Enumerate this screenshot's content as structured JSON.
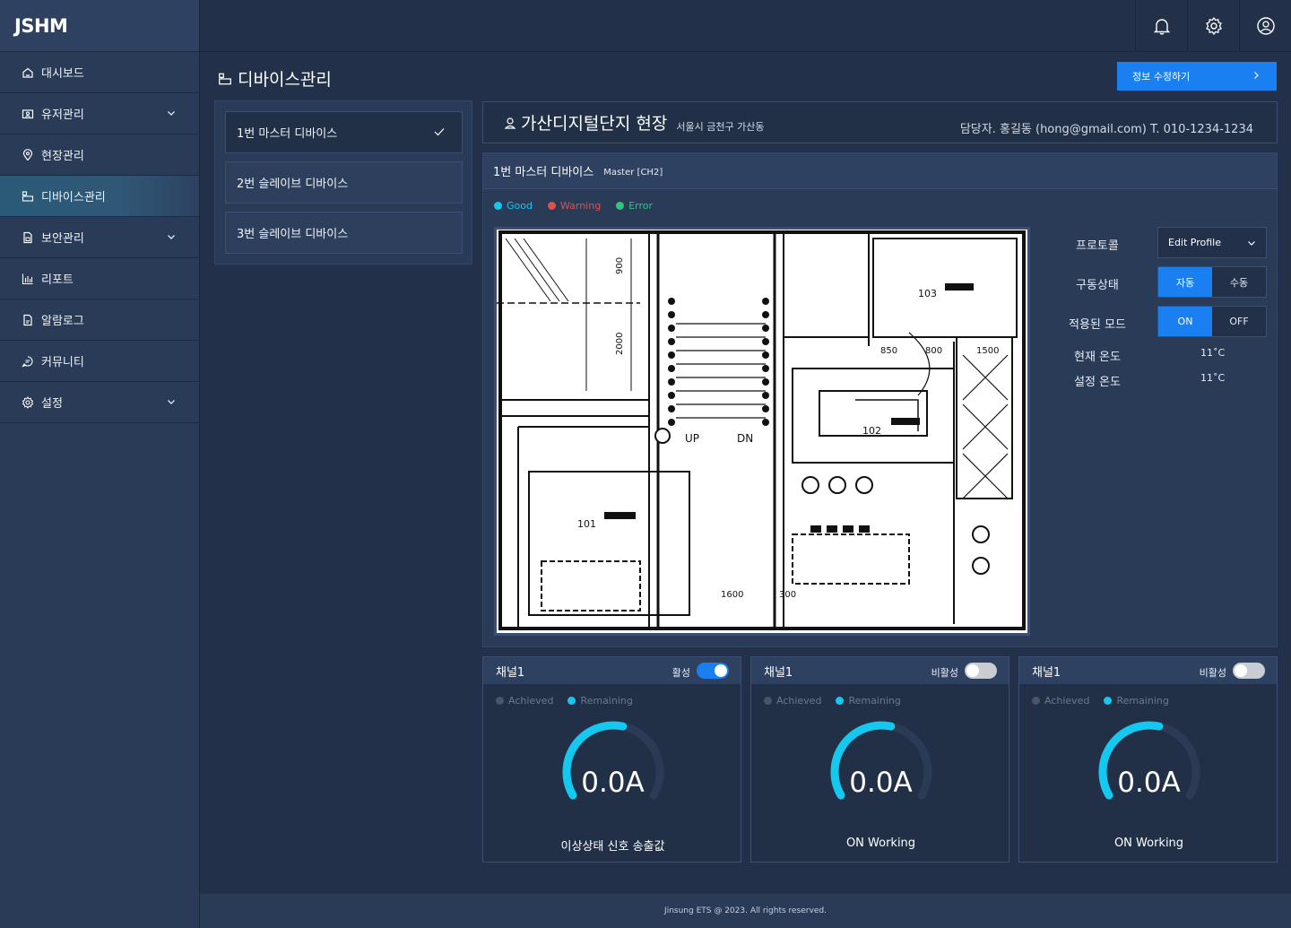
{
  "app": {
    "logo": "JSHM"
  },
  "sidebar": {
    "items": [
      {
        "label": "대시보드",
        "icon": "home-icon",
        "expandable": false
      },
      {
        "label": "유저관리",
        "icon": "user-card-icon",
        "expandable": true
      },
      {
        "label": "현장관리",
        "icon": "location-pin-icon",
        "expandable": false
      },
      {
        "label": "디바이스관리",
        "icon": "device-icon",
        "expandable": false,
        "active": true
      },
      {
        "label": "보안관리",
        "icon": "document-lock-icon",
        "expandable": true
      },
      {
        "label": "리포트",
        "icon": "bar-chart-icon",
        "expandable": false
      },
      {
        "label": "알람로그",
        "icon": "document-alert-icon",
        "expandable": false
      },
      {
        "label": "커뮤니티",
        "icon": "chat-icon",
        "expandable": false
      },
      {
        "label": "설정",
        "icon": "gear-icon",
        "expandable": true
      }
    ]
  },
  "topbar": {
    "icons": [
      "bell-icon",
      "gear-icon",
      "user-circle-icon"
    ]
  },
  "page": {
    "title": "디바이스관리",
    "edit_button": "정보 수정하기"
  },
  "devices": [
    {
      "label": "1번 마스터 디바이스",
      "selected": true
    },
    {
      "label": "2번 슬레이브 디바이스",
      "selected": false
    },
    {
      "label": "3번 슬레이브 디바이스",
      "selected": false
    }
  ],
  "site": {
    "name": "가산디지털단지 현장",
    "address": "서울시 금천구 가산동",
    "contact": "담당자. 홍길동 (hong@gmail.com)  T. 010-1234-1234"
  },
  "device_detail": {
    "title": "1번 마스터 디바이스",
    "subtitle": "Master  [CH2]",
    "legend": [
      {
        "label": "Good",
        "color": "#15c8f0"
      },
      {
        "label": "Warning",
        "color": "#e0504e"
      },
      {
        "label": "Error",
        "color": "#2ec77a"
      }
    ],
    "floorplan_labels": {
      "up": "UP",
      "dn": "DN",
      "r101": "101",
      "r102": "102",
      "r103": "103",
      "d850": "850",
      "d800": "800",
      "d1500": "1500",
      "d1600": "1600",
      "d300": "300",
      "d2000": "2000",
      "d900": "900"
    },
    "properties": {
      "protocol_label": "프로토콜",
      "protocol_value": "Edit Profile",
      "drive_label": "구동상태",
      "drive_options": [
        "자동",
        "수동"
      ],
      "drive_selected": "자동",
      "mode_label": "적용된 모드",
      "mode_options": [
        "ON",
        "OFF"
      ],
      "mode_selected": "ON",
      "current_temp_label": "현재 온도",
      "current_temp": "11˚C",
      "set_temp_label": "설정 온도",
      "set_temp": "11˚C"
    }
  },
  "channels": [
    {
      "title": "채널1",
      "state_label": "활성",
      "enabled": true,
      "achieved": "Achieved",
      "remaining": "Remaining",
      "value": "0.0A",
      "gauge_fraction": 0.55,
      "caption": "이상상태 신호 송출값"
    },
    {
      "title": "채널1",
      "state_label": "비활성",
      "enabled": false,
      "achieved": "Achieved",
      "remaining": "Remaining",
      "value": "0.0A",
      "gauge_fraction": 0.55,
      "caption": "ON Working"
    },
    {
      "title": "채널1",
      "state_label": "비활성",
      "enabled": false,
      "achieved": "Achieved",
      "remaining": "Remaining",
      "value": "0.0A",
      "gauge_fraction": 0.55,
      "caption": "ON Working"
    }
  ],
  "colors": {
    "accent": "#1a7ff0",
    "gauge_active": "#15c8f0",
    "gauge_track": "#2c3b55"
  },
  "footer": {
    "text": "Jinsung ETS @ 2023. All rights reserved."
  }
}
